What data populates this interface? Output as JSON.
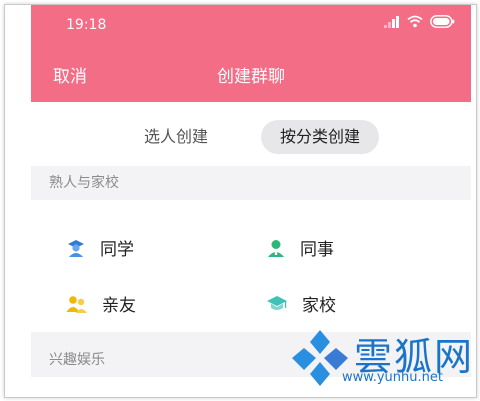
{
  "status": {
    "time": "19:18"
  },
  "header": {
    "cancel_label": "取消",
    "title": "创建群聊"
  },
  "segments": [
    {
      "label": "选人创建"
    },
    {
      "label": "按分类创建"
    }
  ],
  "sections": [
    {
      "title": "熟人与家校"
    },
    {
      "title": "兴趣娱乐"
    }
  ],
  "categories": [
    {
      "label": "同学",
      "icon": "student-icon",
      "color": "#4a90e2"
    },
    {
      "label": "同事",
      "icon": "colleague-icon",
      "color": "#2fb67c"
    },
    {
      "label": "亲友",
      "icon": "friends-icon",
      "color": "#f2b705"
    },
    {
      "label": "家校",
      "icon": "graduation-cap-icon",
      "color": "#3fc2b6"
    }
  ],
  "watermark": {
    "text": "雲狐网",
    "url": "www.yunhu.net"
  },
  "colors": {
    "header": "#f26d85",
    "segment_active_bg": "#e7e7ea"
  }
}
